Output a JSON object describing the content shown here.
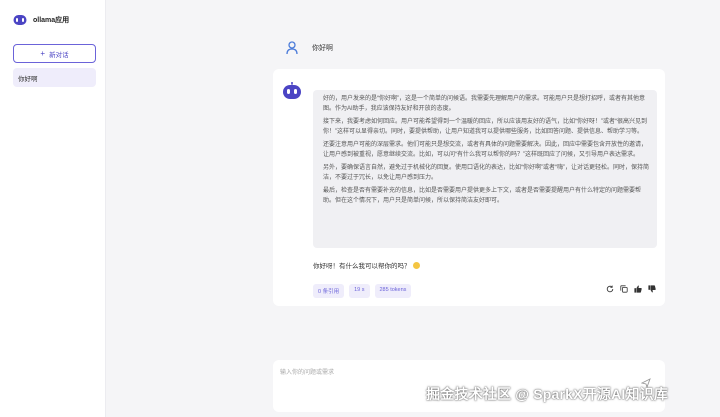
{
  "app": {
    "name": "ollama应用"
  },
  "sidebar": {
    "new_chat_label": "新对话",
    "conversations": [
      {
        "title": "你好啊"
      }
    ]
  },
  "chat": {
    "user_message": "你好啊",
    "reasoning": [
      "好的，用户发来的是“你好啊”，这是一个简单的问候语。我需要先理解用户的需求。可能用户只是想打招呼，或者有其他意图。作为AI助手，我应该保持友好和开放的态度。",
      "接下来，我要考虑如何回应。用户可能希望得到一个温暖的回应，所以应该用友好的语气，比如“你好呀！”或者“很高兴见到你！”这样可以显得亲切。同时，要提供帮助，让用户知道我可以提供哪些服务，比如回答问题、提供信息、帮助学习等。",
      "还要注意用户可能的深层需求。他们可能只是想交流，或者有具体的问题需要解决。因此，回应中需要包含开放性的邀请，让用户感到被重视，愿意继续交流。比如，可以问“有什么我可以帮你的吗？”这样既回应了问候，又引导用户表达需求。",
      "另外，要确保语言自然，避免过于机械化的回复。使用口语化的表达，比如“你好啊”或者“嗨”，让对话更轻松。同时，保持简洁，不要过于冗长，以免让用户感到压力。",
      "最后，检查是否有需要补充的信息，比如是否需要用户提供更多上下文，或者是否需要提醒用户有什么特定的问题需要帮助。但在这个情况下，用户只是简单问候，所以保持简洁友好即可。"
    ],
    "answer": "你好呀！有什么我可以帮你的吗？",
    "meta": {
      "citations": "0 条引用",
      "duration": "19 s",
      "tokens": "285 tokens"
    }
  },
  "input": {
    "placeholder": "输入你的问题或需求"
  },
  "watermark": "掘金技术社区 @ SparkX开源AI知识库",
  "colors": {
    "accent": "#6b63d9",
    "accent_light": "#efedfb",
    "background": "#f5f5f7"
  }
}
